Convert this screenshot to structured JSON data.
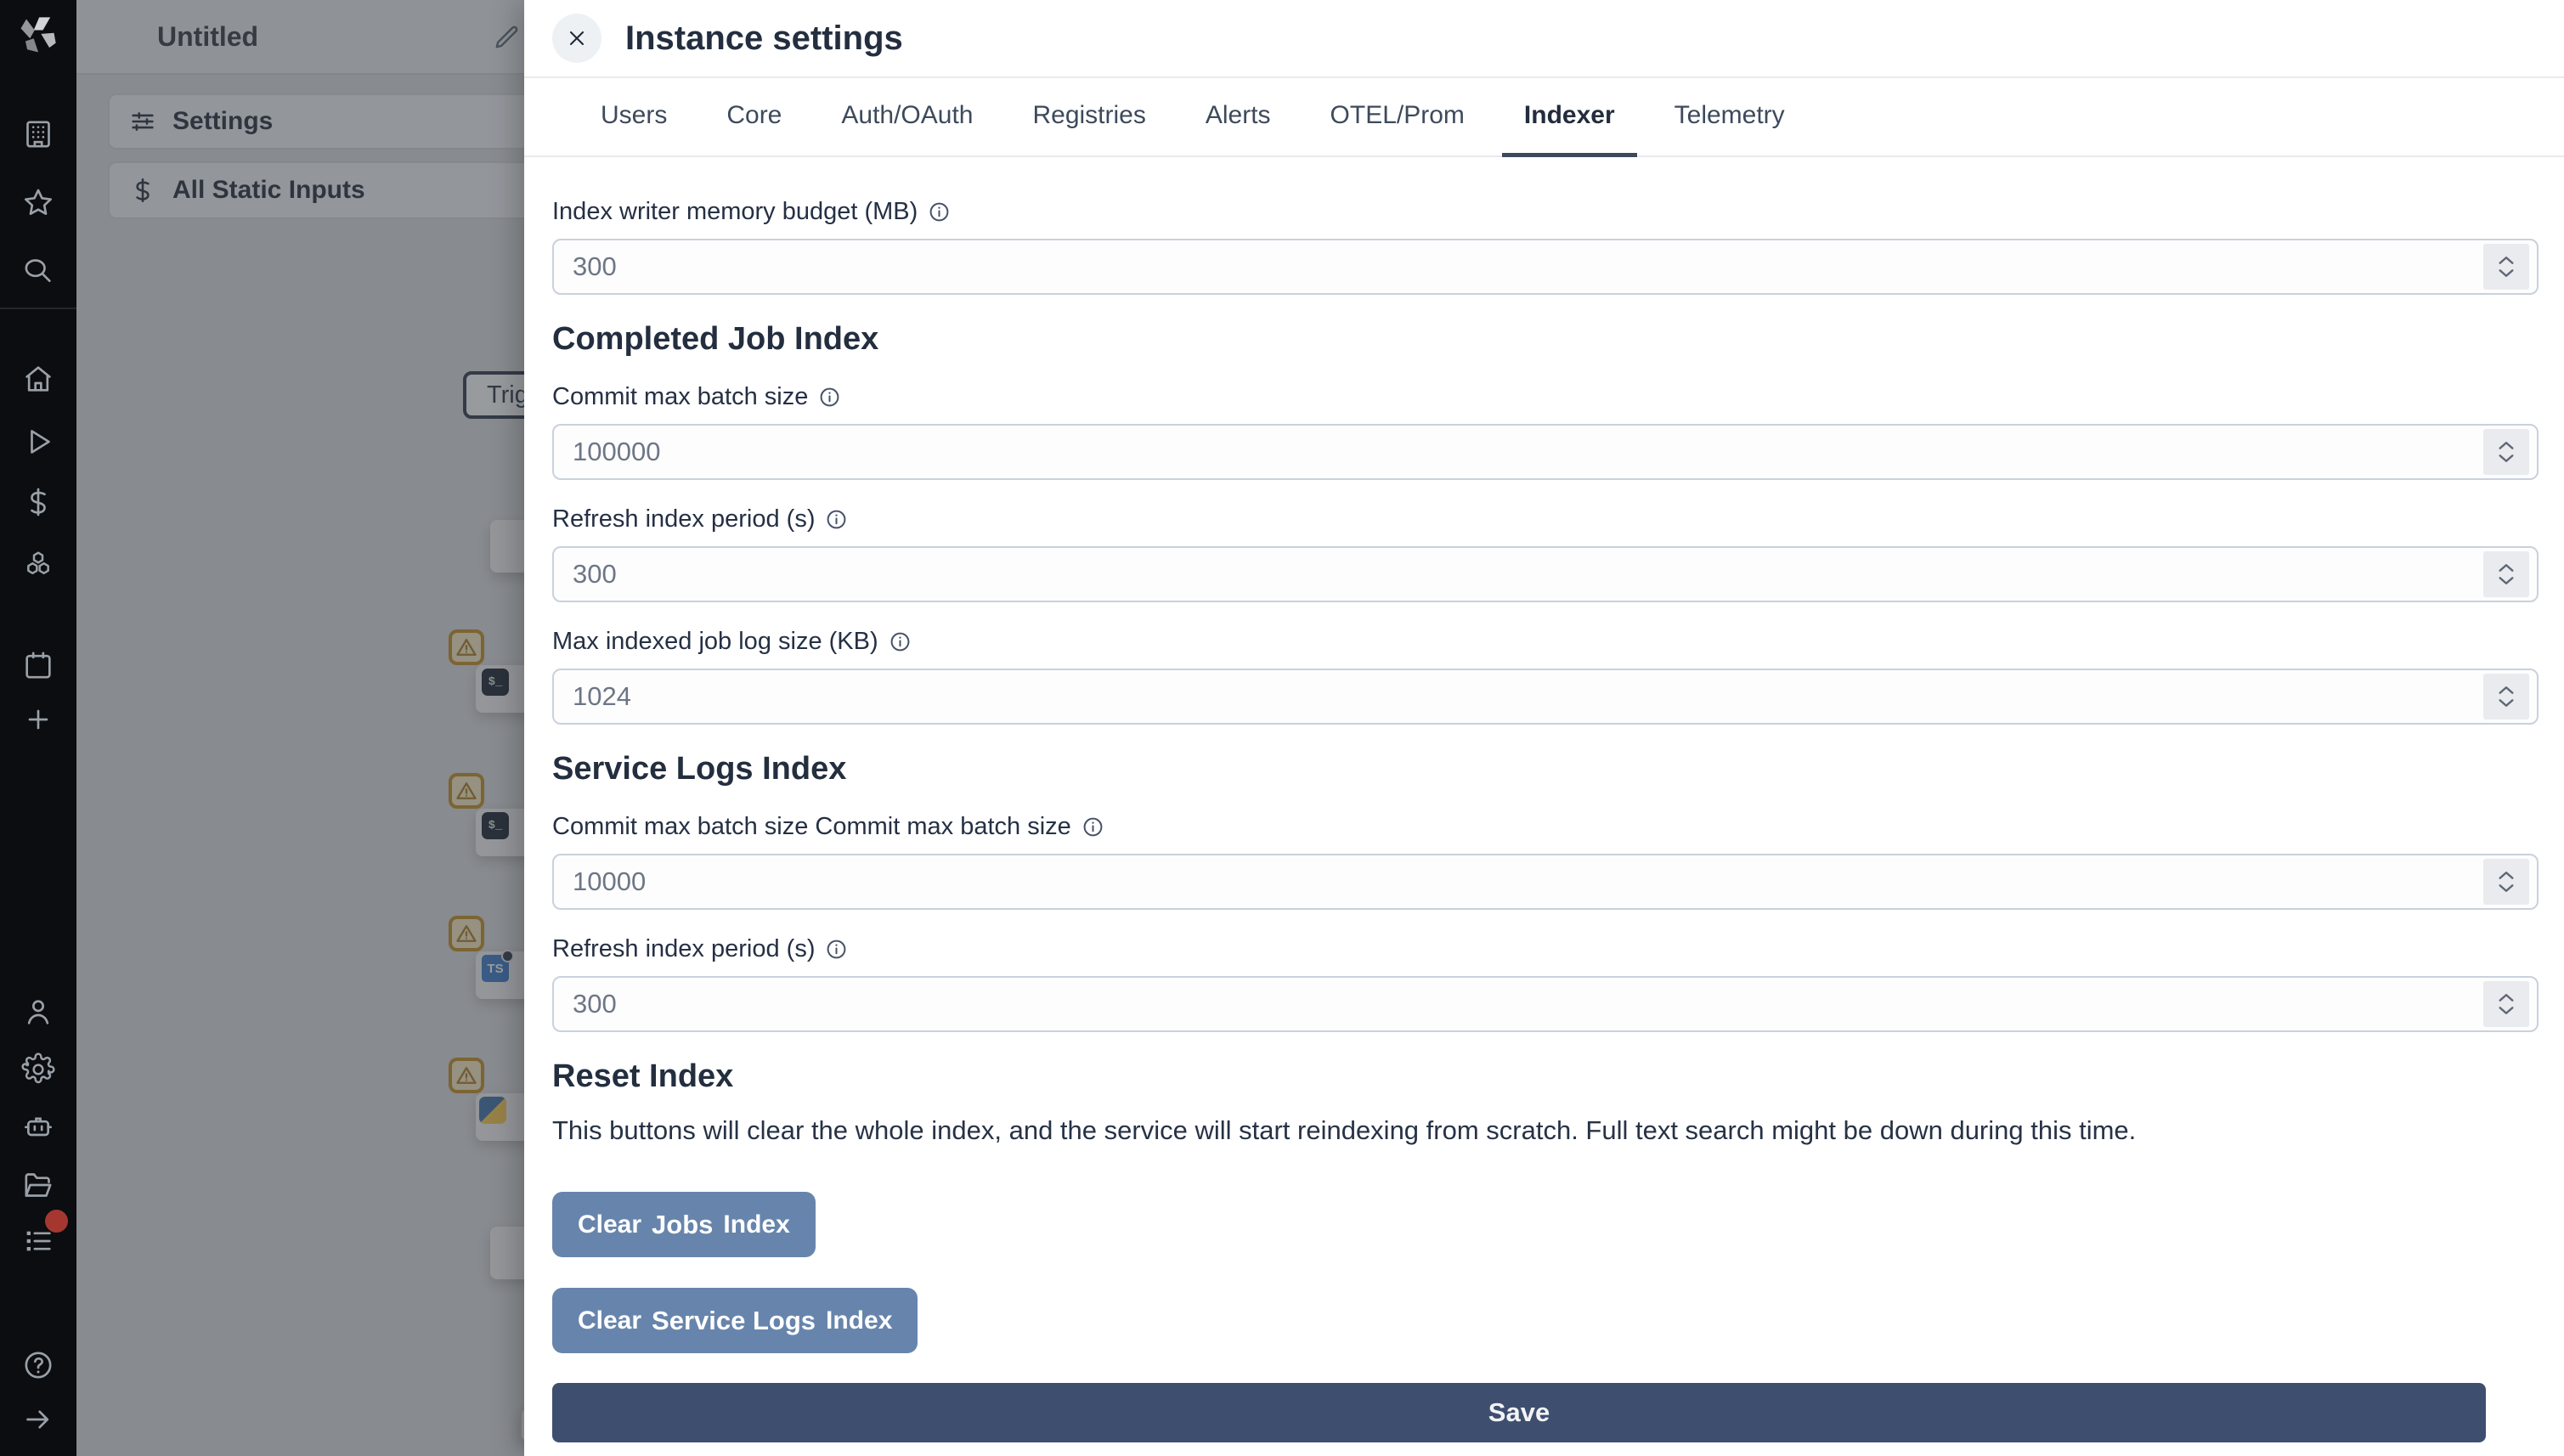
{
  "colors": {
    "sidebar_bg": "#0b0d10",
    "modal_bg": "#ffffff",
    "heading_text": "#232e3f",
    "input_text": "#6d7685",
    "input_border": "#c9d1dc",
    "clear_button_bg": "#6785ac",
    "save_button_bg": "#3e4e6f",
    "active_tab_underline": "#3d4a5c",
    "warning_badge_border": "#c08a1e",
    "notification_dot": "#a43830",
    "backdrop": "rgba(62,65,70,0.52)"
  },
  "sidebar": {
    "logo_icon": "windmill-logo",
    "top_icons": [
      "building-icon",
      "star-icon",
      "search-icon"
    ],
    "middle_icons": [
      "home-icon",
      "play-icon",
      "dollar-icon",
      "cubes-icon",
      "calendar-icon",
      "plus-icon"
    ],
    "lower_icons": [
      "user-icon",
      "gear-icon",
      "robot-icon",
      "folder-open-icon",
      "audit-logs-icon"
    ],
    "bottom_icons": [
      "help-icon",
      "arrow-right-icon"
    ],
    "notification_dot_on": "audit-logs-icon"
  },
  "workspace": {
    "title": "Untitled",
    "rows": [
      {
        "icon": "sliders-icon",
        "label": "Settings"
      },
      {
        "icon": "dollar-icon",
        "label": "All Static Inputs"
      }
    ],
    "flow": {
      "node_label": "Trigg",
      "warning_badge_count": 4,
      "step_icons": [
        "bash-icon",
        "bash-icon",
        "typescript-icon",
        "python-icon"
      ],
      "ts_badge": "TS",
      "bash_badge": "$_"
    }
  },
  "modal": {
    "title": "Instance settings",
    "tabs": [
      "Users",
      "Core",
      "Auth/OAuth",
      "Registries",
      "Alerts",
      "OTEL/Prom",
      "Indexer",
      "Telemetry"
    ],
    "active_tab": "Indexer",
    "indexer": {
      "field_writer": {
        "label": "Index writer memory budget (MB)",
        "value": "300"
      },
      "heading_completed": "Completed Job Index",
      "field_job_commit": {
        "label": "Commit max batch size",
        "value": "100000"
      },
      "field_job_refresh": {
        "label": "Refresh index period (s)",
        "value": "300"
      },
      "field_job_maxlog": {
        "label": "Max indexed job log size (KB)",
        "value": "1024"
      },
      "heading_service": "Service Logs Index",
      "field_svc_commit": {
        "label": "Commit max batch size Commit max batch size",
        "value": "10000"
      },
      "field_svc_refresh": {
        "label": "Refresh index period (s)",
        "value": "300"
      },
      "heading_reset": "Reset Index",
      "reset_description": "This buttons will clear the whole index, and the service will start reindexing from scratch. Full text search might be down during this time.",
      "clear_jobs_button": {
        "pre": "Clear",
        "strong": "Jobs",
        "post": "Index"
      },
      "clear_service_button": {
        "pre": "Clear",
        "strong": "Service Logs",
        "post": "Index"
      },
      "save_button": "Save"
    }
  }
}
